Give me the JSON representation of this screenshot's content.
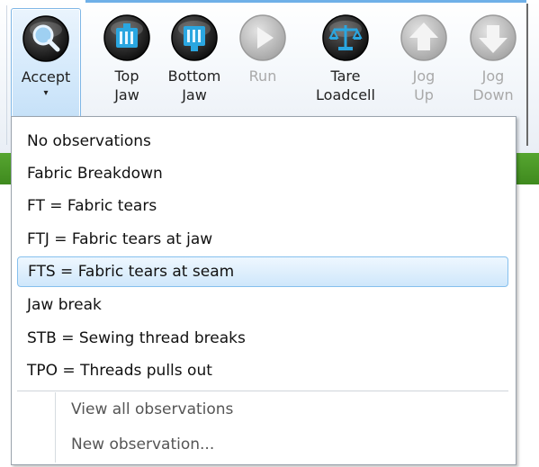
{
  "ribbon": {
    "buttons": [
      {
        "id": "accept",
        "label_lines": [
          "Accept"
        ],
        "icon": "magnifier-icon",
        "dropdown": true,
        "state": "pressed"
      },
      {
        "id": "top_jaw",
        "label_lines": [
          "Top",
          "Jaw"
        ],
        "icon": "top-jaw-icon",
        "state": "enabled"
      },
      {
        "id": "bottom_jaw",
        "label_lines": [
          "Bottom",
          "Jaw"
        ],
        "icon": "bottom-jaw-icon",
        "state": "enabled"
      },
      {
        "id": "run",
        "label_lines": [
          "Run"
        ],
        "icon": "play-icon",
        "state": "disabled"
      },
      {
        "id": "tare_loadcell",
        "label_lines": [
          "Tare",
          "Loadcell"
        ],
        "icon": "scale-icon",
        "state": "enabled"
      },
      {
        "id": "jog_up",
        "label_lines": [
          "Jog",
          "Up"
        ],
        "icon": "arrow-up-icon",
        "state": "disabled"
      },
      {
        "id": "jog_down",
        "label_lines": [
          "Jog",
          "Down"
        ],
        "icon": "arrow-down-icon",
        "state": "disabled"
      }
    ],
    "dropdown_arrow": "▾"
  },
  "menu": {
    "items": [
      "No observations",
      "Fabric Breakdown",
      "FT = Fabric tears",
      "FTJ = Fabric tears at jaw",
      "FTS = Fabric tears at seam",
      "Jaw break",
      "STB = Sewing thread breaks",
      "TPO = Threads pulls out"
    ],
    "selected_index": 4,
    "secondary": [
      "View all observations",
      "New observation..."
    ]
  },
  "colors": {
    "accent_green": "#4a9a26",
    "selection_border": "#86c0ee",
    "ribbon_highlight": "#6fb0e8"
  }
}
